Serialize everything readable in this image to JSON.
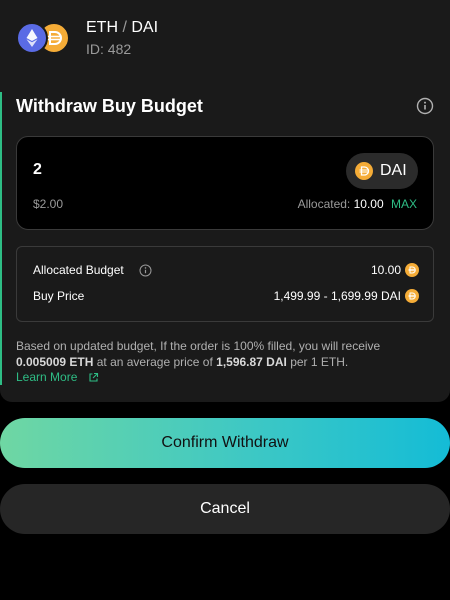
{
  "header": {
    "base_token": "ETH",
    "separator": "/",
    "quote_token": "DAI",
    "id_label": "ID: 482"
  },
  "section": {
    "title": "Withdraw Buy Budget",
    "accent_color": "#2ebd85"
  },
  "input": {
    "amount": "2",
    "token_label": "DAI",
    "usd_value": "$2.00",
    "allocated_label": "Allocated:",
    "allocated_value": "10.00",
    "max_label": "MAX"
  },
  "details": {
    "allocated_budget_label": "Allocated Budget",
    "allocated_budget_value": "10.00",
    "buy_price_label": "Buy Price",
    "buy_price_value": "1,499.99 - 1,699.99 DAI"
  },
  "note": {
    "text_1": "Based on updated budget, If the order is 100% filled, you will receive ",
    "receive_amount": "0.005009 ETH",
    "text_2": " at an average price of ",
    "avg_price": "1,596.87 DAI",
    "text_3": " per 1 ETH.",
    "learn_more": "Learn More"
  },
  "buttons": {
    "confirm_label": "Confirm Withdraw",
    "cancel_label": "Cancel"
  },
  "icons": {
    "eth": "eth-token-icon",
    "dai": "dai-token-icon",
    "info": "info-icon",
    "external": "external-link-icon"
  }
}
